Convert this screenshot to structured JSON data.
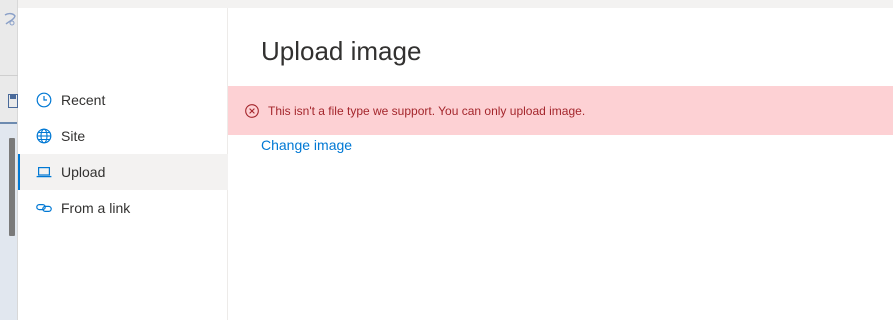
{
  "nav": {
    "items": [
      {
        "label": "Recent",
        "icon": "clock-icon",
        "selected": false
      },
      {
        "label": "Site",
        "icon": "globe-icon",
        "selected": false
      },
      {
        "label": "Upload",
        "icon": "laptop-icon",
        "selected": true
      },
      {
        "label": "From a link",
        "icon": "link-icon",
        "selected": false
      }
    ]
  },
  "main": {
    "title": "Upload image",
    "error": {
      "icon": "error-circle-icon",
      "message": "This isn't a file type we support. You can only upload image."
    },
    "change_link": "Change image"
  },
  "colors": {
    "accent": "#0078d4",
    "error_background": "#fdd1d4",
    "error_text": "#a4262c"
  }
}
